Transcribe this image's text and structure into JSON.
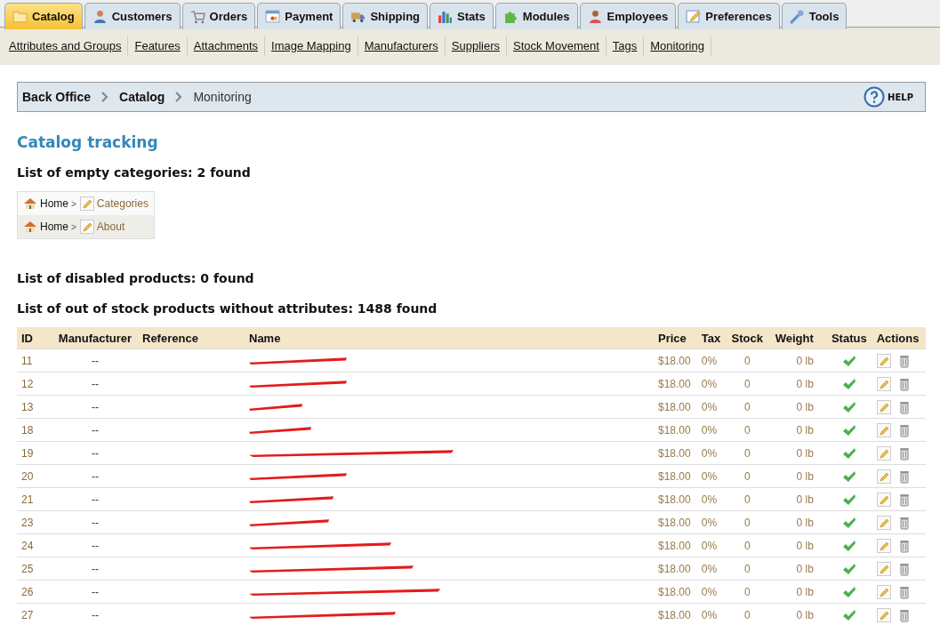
{
  "tabs": [
    {
      "label": "Catalog",
      "selected": true
    },
    {
      "label": "Customers",
      "selected": false
    },
    {
      "label": "Orders",
      "selected": false
    },
    {
      "label": "Payment",
      "selected": false
    },
    {
      "label": "Shipping",
      "selected": false
    },
    {
      "label": "Stats",
      "selected": false
    },
    {
      "label": "Modules",
      "selected": false
    },
    {
      "label": "Employees",
      "selected": false
    },
    {
      "label": "Preferences",
      "selected": false
    },
    {
      "label": "Tools",
      "selected": false
    }
  ],
  "subnav": [
    "Attributes and Groups",
    "Features",
    "Attachments",
    "Image Mapping",
    "Manufacturers",
    "Suppliers",
    "Stock Movement",
    "Tags",
    "Monitoring"
  ],
  "breadcrumb": [
    {
      "label": "Back Office",
      "current": false
    },
    {
      "label": "Catalog",
      "current": false
    },
    {
      "label": "Monitoring",
      "current": true
    }
  ],
  "help": "HELP",
  "title": "Catalog tracking",
  "empty_categories": {
    "heading": "List of empty categories: 2 found",
    "rows": [
      {
        "home": "Home",
        "sep": ">",
        "name": "Categories"
      },
      {
        "home": "Home",
        "sep": ">",
        "name": "About"
      }
    ]
  },
  "disabled_heading": "List of disabled products: 0 found",
  "out_of_stock": {
    "heading": "List of out of stock products without attributes: 1488 found",
    "columns": [
      "ID",
      "Manufacturer",
      "Reference",
      "Name",
      "Price",
      "Tax",
      "Stock",
      "Weight",
      "Status",
      "Actions"
    ],
    "rows": [
      {
        "id": "11",
        "manufacturer": "--",
        "name_redacted": true,
        "price": "$18.00",
        "tax": "0%",
        "stock": "0",
        "weight": "0 lb",
        "active": true
      },
      {
        "id": "12",
        "manufacturer": "--",
        "name_redacted": true,
        "price": "$18.00",
        "tax": "0%",
        "stock": "0",
        "weight": "0 lb",
        "active": true
      },
      {
        "id": "13",
        "manufacturer": "--",
        "name_redacted": true,
        "price": "$18.00",
        "tax": "0%",
        "stock": "0",
        "weight": "0 lb",
        "active": true
      },
      {
        "id": "18",
        "manufacturer": "--",
        "name_redacted": true,
        "price": "$18.00",
        "tax": "0%",
        "stock": "0",
        "weight": "0 lb",
        "active": true
      },
      {
        "id": "19",
        "manufacturer": "--",
        "name_redacted": true,
        "price": "$18.00",
        "tax": "0%",
        "stock": "0",
        "weight": "0 lb",
        "active": true
      },
      {
        "id": "20",
        "manufacturer": "--",
        "name_redacted": true,
        "price": "$18.00",
        "tax": "0%",
        "stock": "0",
        "weight": "0 lb",
        "active": true
      },
      {
        "id": "21",
        "manufacturer": "--",
        "name_redacted": true,
        "price": "$18.00",
        "tax": "0%",
        "stock": "0",
        "weight": "0 lb",
        "active": true
      },
      {
        "id": "23",
        "manufacturer": "--",
        "name_redacted": true,
        "price": "$18.00",
        "tax": "0%",
        "stock": "0",
        "weight": "0 lb",
        "active": true
      },
      {
        "id": "24",
        "manufacturer": "--",
        "name_redacted": true,
        "price": "$18.00",
        "tax": "0%",
        "stock": "0",
        "weight": "0 lb",
        "active": true
      },
      {
        "id": "25",
        "manufacturer": "--",
        "name_redacted": true,
        "price": "$18.00",
        "tax": "0%",
        "stock": "0",
        "weight": "0 lb",
        "active": true
      },
      {
        "id": "26",
        "manufacturer": "--",
        "name_redacted": true,
        "price": "$18.00",
        "tax": "0%",
        "stock": "0",
        "weight": "0 lb",
        "active": true
      },
      {
        "id": "27",
        "manufacturer": "--",
        "name_redacted": true,
        "price": "$18.00",
        "tax": "0%",
        "stock": "0",
        "weight": "0 lb",
        "active": true
      }
    ]
  }
}
